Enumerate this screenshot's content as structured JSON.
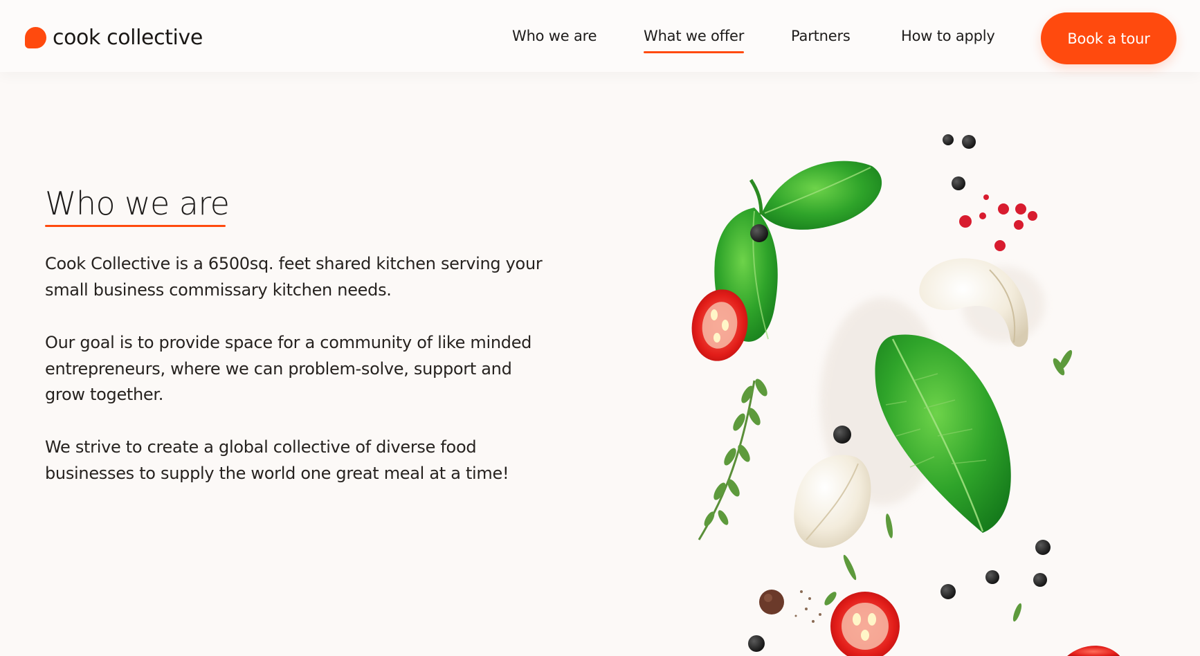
{
  "brand": {
    "name": "cook collective",
    "accent_color": "#ff4a0e"
  },
  "nav": {
    "items": [
      {
        "label": "Who we are",
        "active": false
      },
      {
        "label": "What we offer",
        "active": true
      },
      {
        "label": "Partners",
        "active": false
      },
      {
        "label": "How to apply",
        "active": false
      }
    ],
    "cta_label": "Book a tour"
  },
  "main": {
    "title": "Who we are",
    "paragraphs": [
      "Cook Collective is a 6500sq. feet shared kitchen serving your small business commissary kitchen needs.",
      "Our goal is to provide space for a community of like minded entrepreneurs, where we can problem-solve, support and grow together.",
      "We strive to create a global collective of diverse food businesses to supply the world one great meal at a time!"
    ]
  },
  "illustration": {
    "icon": "food-ingredients-illustration"
  }
}
